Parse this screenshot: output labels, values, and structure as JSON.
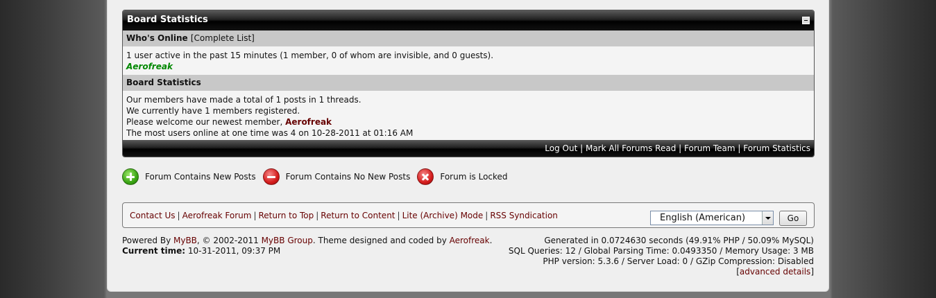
{
  "board_stats": {
    "title": "Board Statistics",
    "whos_online": {
      "heading": "Who's Online",
      "complete_list": "[Complete List]",
      "summary": "1 user active in the past 15 minutes (1 member, 0 of whom are invisible, and 0 guests).",
      "online_user": "Aerofreak"
    },
    "statistics": {
      "heading": "Board Statistics",
      "posts_line": "Our members have made a total of 1 posts in 1 threads.",
      "members_line": "We currently have 1 members registered.",
      "welcome_prefix": "Please welcome our newest member, ",
      "newest_member": "Aerofreak",
      "record_line": "The most users online at one time was 4 on 10-28-2011 at 01:16 AM"
    },
    "footer_links": [
      "Log Out",
      "Mark All Forums Read",
      "Forum Team",
      "Forum Statistics"
    ]
  },
  "legend": {
    "new_posts": "Forum Contains New Posts",
    "no_new_posts": "Forum Contains No New Posts",
    "locked": "Forum is Locked"
  },
  "footer": {
    "links": [
      "Contact Us",
      "Aerofreak Forum",
      "Return to Top",
      "Return to Content",
      "Lite (Archive) Mode",
      "RSS Syndication"
    ],
    "language": "English (American)",
    "go_label": "Go"
  },
  "powered": {
    "prefix": "Powered By ",
    "mybb": "MyBB",
    "copyright": ", © 2002-2011 ",
    "mybb_group": "MyBB Group",
    "theme_text": ". Theme designed and coded by ",
    "author": "Aerofreak",
    "suffix": ".",
    "current_time_label": "Current time:",
    "current_time": " 10-31-2011, 09:37 PM"
  },
  "debug": {
    "generated": "Generated in 0.0724630 seconds (49.91% PHP / 50.09% MySQL)",
    "sql": "SQL Queries: 12 / Global Parsing Time: 0.0493350 / Memory Usage: 3 MB",
    "php": "PHP version: 5.3.6 / Server Load: 0 / GZip Compression: Disabled",
    "advanced": "advanced details"
  }
}
